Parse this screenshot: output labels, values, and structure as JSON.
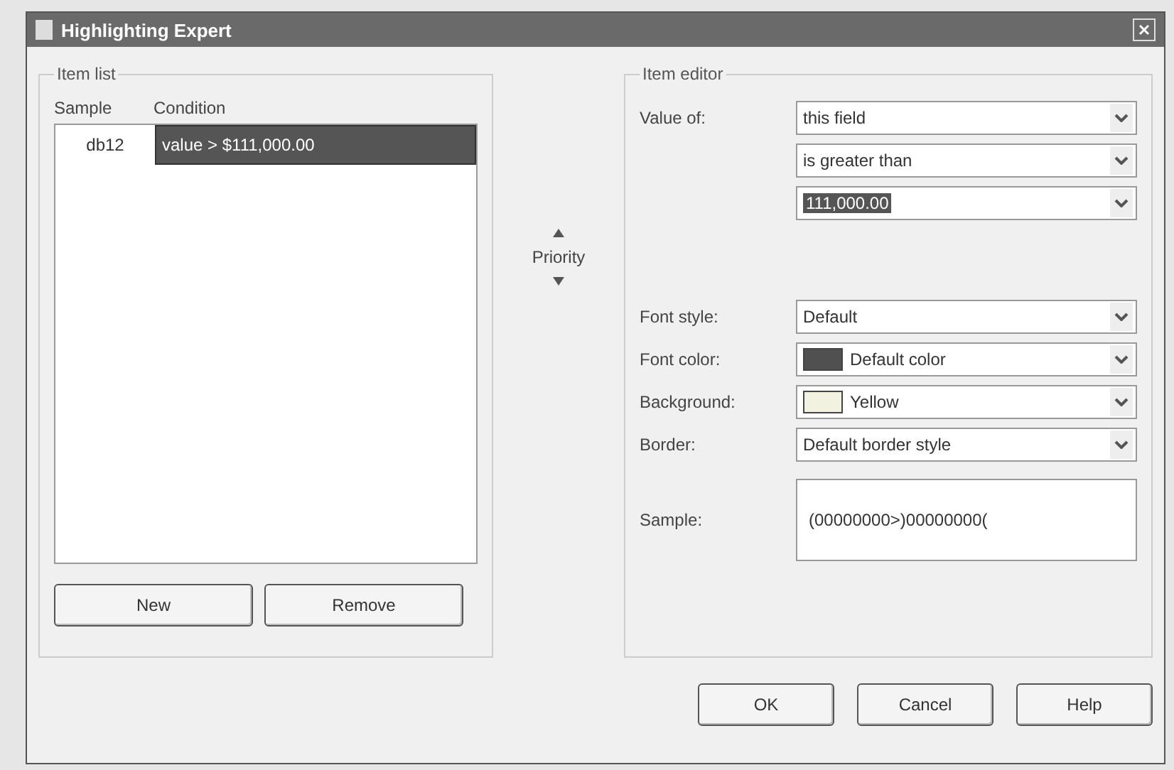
{
  "window": {
    "title": "Highlighting Expert"
  },
  "item_list": {
    "label": "Item list",
    "columns": [
      "Sample",
      "Condition"
    ],
    "rows": [
      {
        "sample": "db12",
        "condition": "value > $111,000.00",
        "selected": true
      }
    ],
    "buttons": [
      "New",
      "Remove"
    ]
  },
  "priority": {
    "label": "Priority"
  },
  "item_editor": {
    "label": "Item editor",
    "condition": [
      {
        "label": "Value of:",
        "value": "this field",
        "highlighted": false
      },
      {
        "value": "is greater than",
        "highlighted": false
      },
      {
        "value": "111,000.00",
        "highlighted": true
      }
    ],
    "format": [
      {
        "kind": "combo",
        "label": "Font style:",
        "value": "Default"
      },
      {
        "kind": "swatch",
        "label": "Font color:",
        "value": "Default color",
        "color": "#505050"
      },
      {
        "kind": "swatch",
        "label": "Background:",
        "value": "Yellow",
        "color": "#f2f2e0"
      },
      {
        "kind": "combo",
        "label": "Border:",
        "value": "Default border style"
      }
    ],
    "sample": {
      "label": "Sample:",
      "value": "(00000000>)00000000("
    }
  },
  "buttons": [
    "OK",
    "Cancel",
    "Help"
  ]
}
